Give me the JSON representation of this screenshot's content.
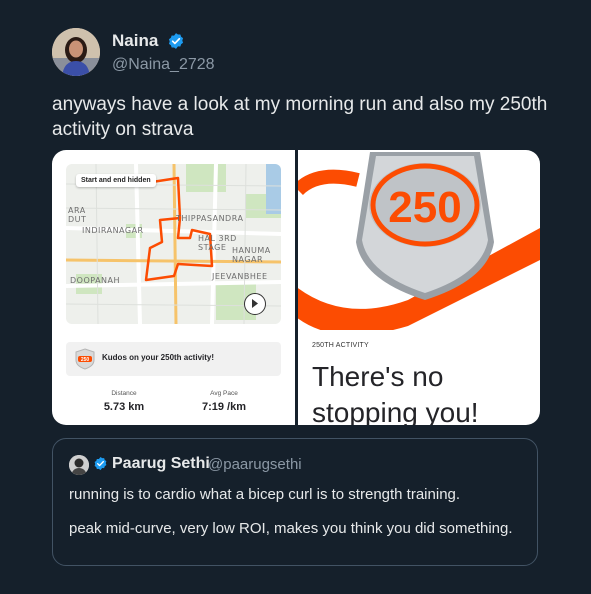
{
  "tweet": {
    "author_name": "Naina",
    "author_handle": "@Naina_2728",
    "text": "anyways have a look at my morning run and also my 250th activity on strava"
  },
  "media": {
    "left_panel": {
      "map_badge": "Start and end hidden",
      "map_labels": [
        "INDIRANAGAR",
        "THIPPASANDRA",
        "HAL 3RD STAGE",
        "HANUMA NAGAR",
        "JEEVANBHEE",
        "DOOPANAH",
        "ARA",
        "DUT"
      ],
      "kudos_text": "Kudos on your 250th activity!",
      "badge_number": "250",
      "stats": [
        {
          "label": "Distance",
          "value": "5.73 km"
        },
        {
          "label": "Avg Pace",
          "value": "7:19 /km"
        }
      ]
    },
    "right_panel": {
      "badge_number": "250",
      "activity_label": "250TH ACTIVITY",
      "headline": "There's no stopping you!"
    }
  },
  "quoted_tweet": {
    "author_name": "Paarug Sethi",
    "author_handle": "@paarugsethi",
    "line1": "running is to cardio what a bicep curl is to strength training.",
    "line2": "peak mid-curve, very low ROI, makes you think you did something."
  },
  "colors": {
    "background": "#15202b",
    "verified_blue": "#1d9bf0",
    "strava_orange": "#fc4c02",
    "border": "#425364"
  },
  "icons": [
    "verified-badge-icon",
    "play-icon"
  ]
}
